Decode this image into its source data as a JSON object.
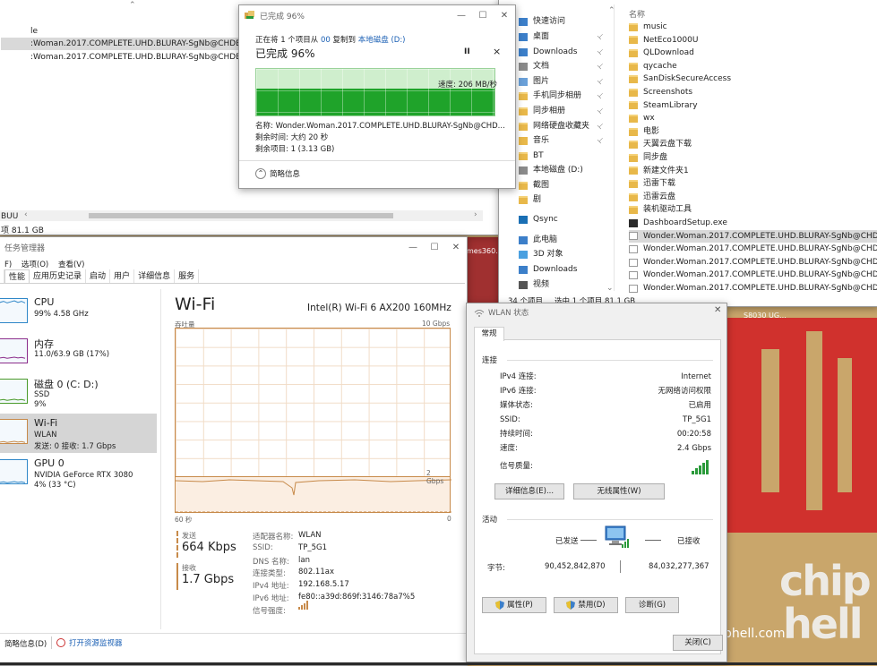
{
  "explorer_left": {
    "rows": [
      "le",
      ":Woman.2017.COMPLETE.UHD.BLURAY-SgNb@CHDBits2.",
      ":Woman.2017.COMPLETE.UHD.BLURAY-SgNb@CHDBits0."
    ],
    "status_left": "BUU",
    "status_size": "项 81.1 GB"
  },
  "copy_dialog": {
    "title": "已完成 96%",
    "copying_prefix": "正在将 1 个项目从 ",
    "source": "00",
    "copying_mid": " 复制到 ",
    "dest": "本地磁盘 (D:)",
    "percent_label": "已完成 96%",
    "pause": "II",
    "close": "×",
    "speed": "速度: 206 MB/秒",
    "name_line": "名称: Wonder.Woman.2017.COMPLETE.UHD.BLURAY-SgNb@CHD...",
    "time_line": "剩余时间: 大约 20 秒",
    "items_line": "剩余项目: 1 (3.13 GB)",
    "less_info": "简略信息",
    "progress": 0.96
  },
  "explorer_right": {
    "nav": [
      {
        "label": "快速访问",
        "pin": false,
        "icon": "star"
      },
      {
        "label": "桌面",
        "pin": true,
        "icon": "desktop"
      },
      {
        "label": "Downloads",
        "pin": true,
        "icon": "download"
      },
      {
        "label": "文档",
        "pin": true,
        "icon": "doc"
      },
      {
        "label": "图片",
        "pin": true,
        "icon": "picture"
      },
      {
        "label": "手机同步相册",
        "pin": true,
        "icon": "folder"
      },
      {
        "label": "同步相册",
        "pin": true,
        "icon": "folder"
      },
      {
        "label": "网络硬盘收藏夹",
        "pin": true,
        "icon": "folder"
      },
      {
        "label": "音乐",
        "pin": true,
        "icon": "music"
      },
      {
        "label": "BT",
        "pin": false,
        "icon": "folder"
      },
      {
        "label": "本地磁盘 (D:)",
        "pin": false,
        "icon": "drive"
      },
      {
        "label": "截图",
        "pin": false,
        "icon": "folder"
      },
      {
        "label": "剧",
        "pin": false,
        "icon": "folder"
      },
      {
        "label": "Qsync",
        "pin": false,
        "icon": "qsync"
      },
      {
        "label": "此电脑",
        "pin": false,
        "icon": "pc"
      },
      {
        "label": "3D 对象",
        "pin": false,
        "icon": "3d"
      },
      {
        "label": "Downloads",
        "pin": false,
        "icon": "download"
      },
      {
        "label": "视频",
        "pin": false,
        "icon": "video"
      }
    ],
    "column_header": "名称",
    "files": [
      {
        "name": "music",
        "type": "folder"
      },
      {
        "name": "NetEco1000U",
        "type": "folder"
      },
      {
        "name": "QLDownload",
        "type": "folder"
      },
      {
        "name": "qycache",
        "type": "folder"
      },
      {
        "name": "SanDiskSecureAccess",
        "type": "folder"
      },
      {
        "name": "Screenshots",
        "type": "folder"
      },
      {
        "name": "SteamLibrary",
        "type": "folder"
      },
      {
        "name": "wx",
        "type": "folder"
      },
      {
        "name": "电影",
        "type": "folder"
      },
      {
        "name": "天翼云盘下载",
        "type": "folder"
      },
      {
        "name": "同步盘",
        "type": "folder"
      },
      {
        "name": "新建文件夹1",
        "type": "folder"
      },
      {
        "name": "迅雷下载",
        "type": "folder"
      },
      {
        "name": "迅雷云盘",
        "type": "folder"
      },
      {
        "name": "装机驱动工具",
        "type": "folder"
      },
      {
        "name": "DashboardSetup.exe",
        "type": "exe"
      },
      {
        "name": "Wonder.Woman.2017.COMPLETE.UHD.BLURAY-SgNb@CHDBits0.",
        "type": "file",
        "selected": true
      },
      {
        "name": "Wonder.Woman.2017.COMPLETE.UHD.BLURAY-SgNb@CHDBits6.",
        "type": "file"
      },
      {
        "name": "Wonder.Woman.2017.COMPLETE.UHD.BLURAY-SgNb@CHDBits7.",
        "type": "file"
      },
      {
        "name": "Wonder.Woman.2017.COMPLETE.UHD.BLURAY-SgNb@CHDBits8.",
        "type": "file"
      },
      {
        "name": "Wonder.Woman.2017.COMPLETE.UHD.BLURAY-SgNb@CHDBits1.",
        "type": "file"
      }
    ],
    "status_count": "34 个项目",
    "status_sel": "选中 1 个项目  81.1 GB"
  },
  "task_manager": {
    "title": "任务管理器",
    "menu": [
      "F)",
      "选项(O)",
      "查看(V)"
    ],
    "tabs": [
      "性能",
      "应用历史记录",
      "启动",
      "用户",
      "详细信息",
      "服务"
    ],
    "resources": [
      {
        "name": "CPU",
        "s1": "99% 4.58 GHz",
        "s2": "",
        "color": "#2f87c8"
      },
      {
        "name": "内存",
        "s1": "11.0/63.9 GB (17%)",
        "s2": "",
        "color": "#8b2d8b"
      },
      {
        "name": "磁盘 0 (C: D:)",
        "s1": "SSD",
        "s2": "9%",
        "color": "#4a9a2a"
      },
      {
        "name": "Wi-Fi",
        "s1": "WLAN",
        "s2": "发送: 0 接收: 1.7 Gbps",
        "color": "#c78a4a",
        "selected": true
      },
      {
        "name": "GPU 0",
        "s1": "NVIDIA GeForce RTX 3080",
        "s2": "4% (33 °C)",
        "color": "#2f87c8"
      }
    ],
    "heading": "Wi-Fi",
    "adapter": "Intel(R) Wi-Fi 6 AX200 160MHz",
    "throughput_label": "吞吐量",
    "max_label": "10 Gbps",
    "mid_label": "2 Gbps",
    "time_left": "60 秒",
    "time_right": "0",
    "send_label": "发送",
    "send_value": "664 Kbps",
    "recv_label": "接收",
    "recv_value": "1.7 Gbps",
    "props": [
      {
        "k": "适配器名称:",
        "v": "WLAN"
      },
      {
        "k": "SSID:",
        "v": "TP_5G1"
      },
      {
        "k": "DNS 名称:",
        "v": "lan"
      },
      {
        "k": "连接类型:",
        "v": "802.11ax"
      },
      {
        "k": "IPv4 地址:",
        "v": "192.168.5.17"
      },
      {
        "k": "IPv6 地址:",
        "v": "fe80::a39d:869f:3146:78a7%5"
      },
      {
        "k": "信号强度:",
        "v": ""
      }
    ],
    "footer_less": "简略信息(D)",
    "footer_monitor": "打开资源监视器"
  },
  "wlan_dialog": {
    "title": "WLAN 状态",
    "tab": "常规",
    "section_conn": "连接",
    "rows": [
      {
        "k": "IPv4 连接:",
        "v": "Internet"
      },
      {
        "k": "IPv6 连接:",
        "v": "无网络访问权限"
      },
      {
        "k": "媒体状态:",
        "v": "已启用"
      },
      {
        "k": "SSID:",
        "v": "TP_5G1"
      },
      {
        "k": "持续时间:",
        "v": "00:20:58"
      },
      {
        "k": "速度:",
        "v": "2.4 Gbps"
      }
    ],
    "signal_label": "信号质量:",
    "btn_details": "详细信息(E)...",
    "btn_wireless": "无线属性(W)",
    "section_activity": "活动",
    "sent_label": "已发送",
    "recv_label": "已接收",
    "bytes_label": "字节:",
    "bytes_sent": "90,452,842,870",
    "bytes_recv": "84,032,277,367",
    "btn_props": "属性(P)",
    "btn_disable": "禁用(D)",
    "btn_diagnose": "诊断(G)",
    "btn_close": "关闭(C)"
  },
  "desktop": {
    "watermark_url": "www.chiphell.com",
    "logo_line1": "chip",
    "logo_line2": "hell",
    "label_fragment": "S8030 UG...",
    "behind_fragment": "mes360.png"
  }
}
